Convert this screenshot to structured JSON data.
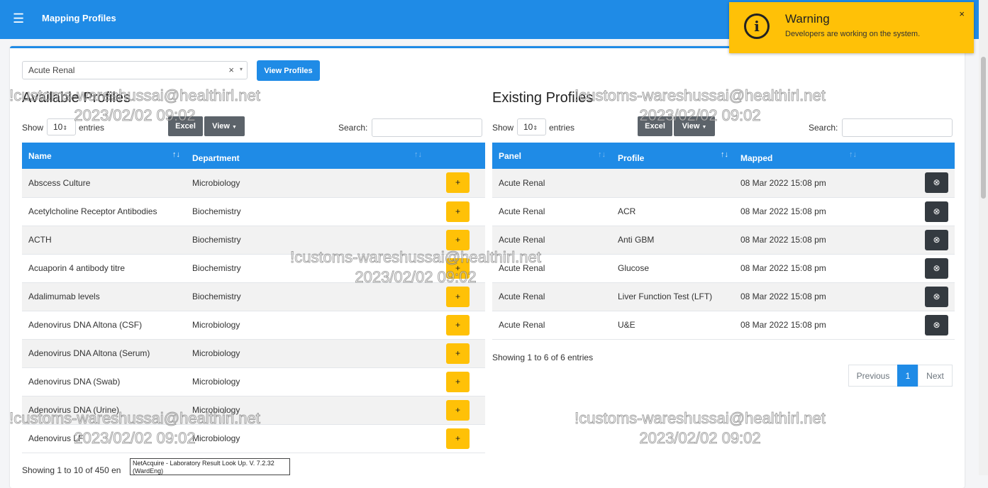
{
  "header": {
    "menu_icon": "hamburger-icon",
    "title": "Mapping Profiles"
  },
  "profile_select": {
    "value": "Acute Renal",
    "clear": "×",
    "caret": "▾"
  },
  "view_profiles_label": "View Profiles",
  "available": {
    "title": "Available Profiles",
    "show_label": "Show",
    "entries_value": "10",
    "entries_label": "entries",
    "excel_label": "Excel",
    "view_label": "View",
    "search_label": "Search:",
    "columns": [
      "Name",
      "Department",
      ""
    ],
    "add_label": "+",
    "rows": [
      {
        "name": "Abscess Culture",
        "department": "Microbiology"
      },
      {
        "name": "Acetylcholine Receptor Antibodies",
        "department": "Biochemistry"
      },
      {
        "name": "ACTH",
        "department": "Biochemistry"
      },
      {
        "name": "Acuaporin 4 antibody titre",
        "department": "Biochemistry"
      },
      {
        "name": "Adalimumab levels",
        "department": "Biochemistry"
      },
      {
        "name": "Adenovirus DNA Altona (CSF)",
        "department": "Microbiology"
      },
      {
        "name": "Adenovirus DNA Altona (Serum)",
        "department": "Microbiology"
      },
      {
        "name": "Adenovirus DNA (Swab)",
        "department": "Microbiology"
      },
      {
        "name": "Adenovirus DNA (Urine)",
        "department": "Microbiology"
      },
      {
        "name": "Adenovirus LF",
        "department": "Microbiology"
      }
    ],
    "info": "Showing 1 to 10 of 450 en"
  },
  "existing": {
    "title": "Existing Profiles",
    "show_label": "Show",
    "entries_value": "10",
    "entries_label": "entries",
    "excel_label": "Excel",
    "view_label": "View",
    "search_label": "Search:",
    "columns": [
      "Panel",
      "Profile",
      "Mapped",
      ""
    ],
    "delete_icon": "⊗",
    "rows": [
      {
        "panel": "Acute Renal",
        "profile": "",
        "mapped": "08 Mar 2022 15:08 pm"
      },
      {
        "panel": "Acute Renal",
        "profile": "ACR",
        "mapped": "08 Mar 2022 15:08 pm"
      },
      {
        "panel": "Acute Renal",
        "profile": "Anti GBM",
        "mapped": "08 Mar 2022 15:08 pm"
      },
      {
        "panel": "Acute Renal",
        "profile": "Glucose",
        "mapped": "08 Mar 2022 15:08 pm"
      },
      {
        "panel": "Acute Renal",
        "profile": "Liver Function Test (LFT)",
        "mapped": "08 Mar 2022 15:08 pm"
      },
      {
        "panel": "Acute Renal",
        "profile": "U&E",
        "mapped": "08 Mar 2022 15:08 pm"
      }
    ],
    "info": "Showing 1 to 6 of 6 entries",
    "pagination": {
      "previous": "Previous",
      "current": "1",
      "next": "Next"
    }
  },
  "toast": {
    "icon": "info-icon",
    "title": "Warning",
    "message": "Developers are working on the system.",
    "close": "×"
  },
  "tooltip": "NetAcquire - Laboratory Result Look Up. V. 7.2.32 (WardEng)",
  "watermark": {
    "line1": "!customs-wareshussai@healthirl.net",
    "line2": "2023/02/02 09:02"
  },
  "colors": {
    "primary": "#1f8be6",
    "warning": "#ffc107",
    "dark": "#343a40",
    "secondary": "#5c636a"
  }
}
